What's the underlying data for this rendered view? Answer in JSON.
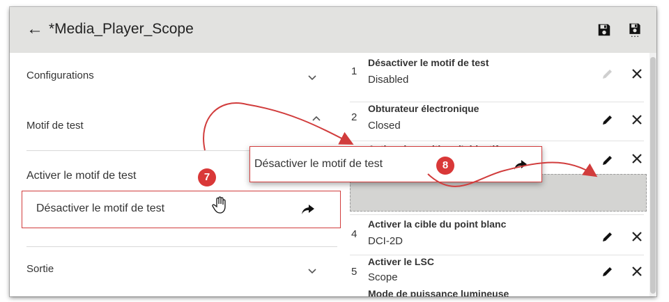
{
  "header": {
    "back_icon": "←",
    "title": "*Media_Player_Scope",
    "save_icon": "save-icon",
    "save_as_icon": "save-as-icon"
  },
  "left_panel": {
    "sections": [
      {
        "label": "Configurations",
        "expanded": false
      },
      {
        "label": "Motif de test",
        "expanded": true
      },
      {
        "label": "Sortie",
        "expanded": false
      }
    ],
    "items": [
      {
        "label": "Activer le motif de test"
      },
      {
        "label": "Désactiver le motif de test"
      }
    ]
  },
  "right_panel": {
    "steps": [
      {
        "num": "1",
        "title": "Désactiver le motif de test",
        "value": "Disabled",
        "edit_enabled": false
      },
      {
        "num": "2",
        "title": "Obturateur électronique",
        "value": "Closed",
        "edit_enabled": true
      },
      {
        "num": "",
        "title": "Activer la position d'objectif",
        "value": "",
        "edit_enabled": true
      },
      {
        "num": "4",
        "title": "Activer la cible du point blanc",
        "value": "DCI-2D",
        "edit_enabled": true
      },
      {
        "num": "5",
        "title": "Activer le LSC",
        "value": "Scope",
        "edit_enabled": true
      },
      {
        "num": "",
        "title": "Mode de puissance lumineuse",
        "value": "",
        "edit_enabled": true
      }
    ]
  },
  "drag_preview": {
    "label": "Désactiver le motif de test"
  },
  "callouts": {
    "badge_1": "7",
    "badge_2": "8"
  },
  "colors": {
    "header_bg": "#e2e2e0",
    "accent_red": "#d13c3c",
    "badge_red": "#d93838",
    "drop_zone": "#d4d4d2"
  }
}
